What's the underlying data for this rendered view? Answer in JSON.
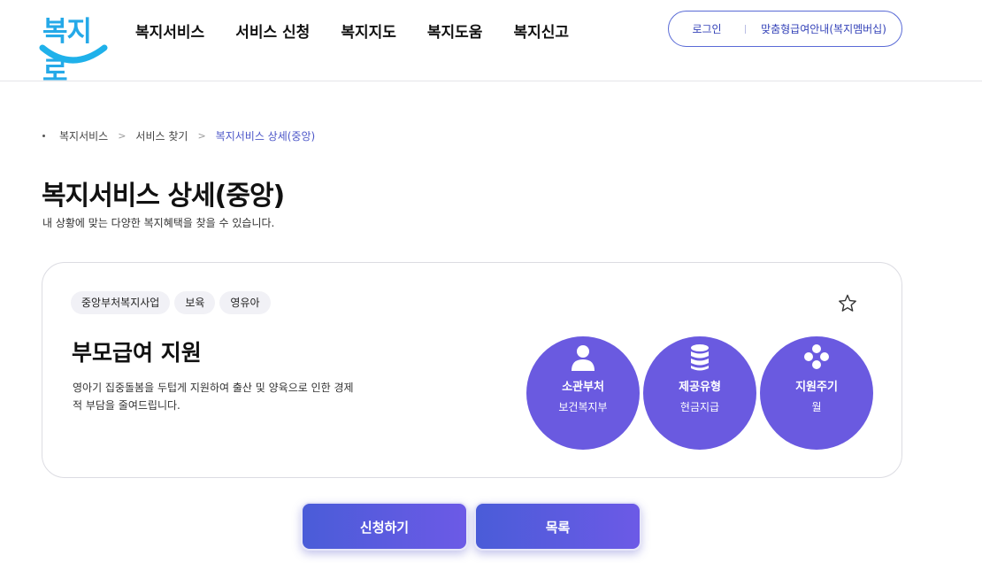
{
  "header": {
    "logo_text": "복지로",
    "nav": [
      "복지서비스",
      "서비스 신청",
      "복지지도",
      "복지도움",
      "복지신고"
    ],
    "login_label": "로그인",
    "membership_label": "맞춤형급여안내(복지멤버십)"
  },
  "breadcrumb": {
    "items": [
      "복지서비스",
      "서비스 찾기"
    ],
    "current": "복지서비스 상세(중앙)"
  },
  "page": {
    "title": "복지서비스 상세(중앙)",
    "subtitle": "내 상황에 맞는 다양한 복지혜택을 찾을 수 있습니다."
  },
  "service": {
    "tags": [
      "중앙부처복지사업",
      "보육",
      "영유아"
    ],
    "title": "부모급여 지원",
    "description": "영아기 집중돌봄을 두텁게 지원하여 출산 및 양육으로 인한 경제적 부담을 줄여드립니다.",
    "info": [
      {
        "label": "소관부처",
        "value": "보건복지부",
        "icon": "person-icon"
      },
      {
        "label": "제공유형",
        "value": "현금지급",
        "icon": "coins-icon"
      },
      {
        "label": "지원주기",
        "value": "월",
        "icon": "cycle-dots-icon"
      }
    ]
  },
  "actions": {
    "apply_label": "신청하기",
    "list_label": "목록"
  },
  "colors": {
    "accent": "#6a5ae0",
    "link": "#4c56c8",
    "logo": "#25a9e8"
  }
}
